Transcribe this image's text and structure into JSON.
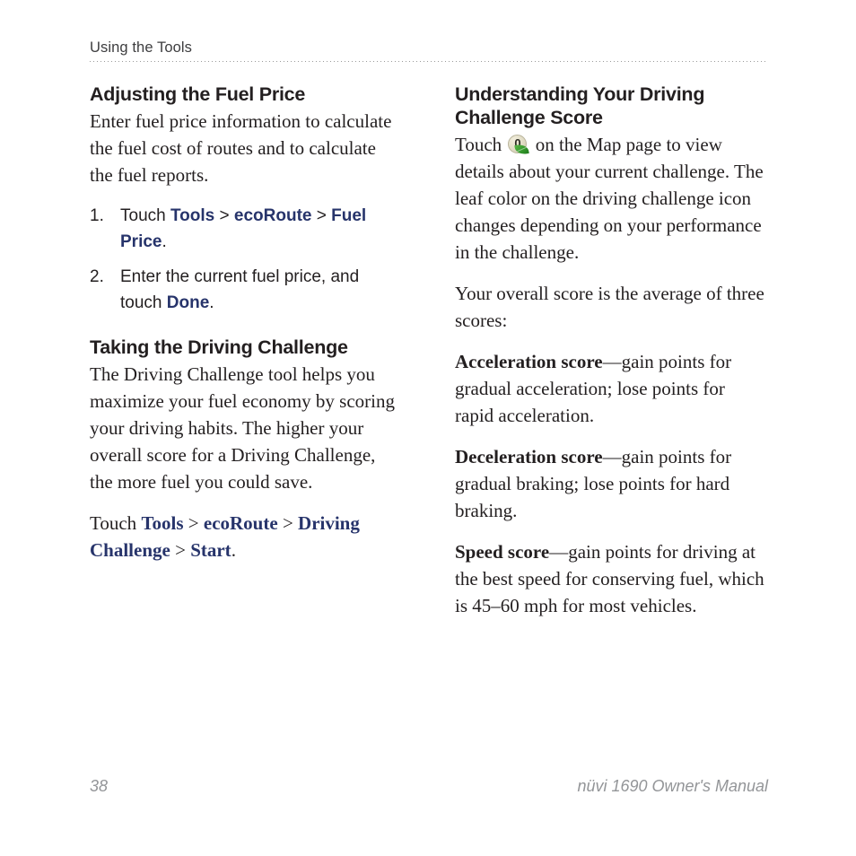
{
  "header": {
    "running_head": "Using the Tools"
  },
  "left_column": {
    "section1": {
      "heading": "Adjusting the Fuel Price",
      "intro": "Enter fuel price information to calculate the fuel cost of routes and to calculate the fuel reports.",
      "steps": [
        {
          "number": "1.",
          "prefix": "Touch ",
          "parts": [
            "Tools",
            " > ",
            "ecoRoute",
            " > ",
            "Fuel Price"
          ],
          "suffix": "."
        },
        {
          "number": "2.",
          "prefix": "Enter the current fuel price, and touch ",
          "parts": [
            "Done"
          ],
          "suffix": "."
        }
      ]
    },
    "section2": {
      "heading": "Taking the Driving Challenge",
      "intro": "The Driving Challenge tool helps you maximize your fuel economy by scoring your driving habits. The higher your overall score for a Driving Challenge, the more fuel you could save.",
      "path_sentence": {
        "prefix": "Touch ",
        "item1": "Tools",
        "sep1": " > ",
        "item2": "ecoRoute",
        "sep2": " > ",
        "item3": "Driving Challenge",
        "sep3": " > ",
        "item4": "Start",
        "suffix": "."
      }
    }
  },
  "right_column": {
    "heading": "Understanding Your Driving Challenge Score",
    "intro_before_icon": "Touch ",
    "icon": {
      "name": "driving-challenge-icon",
      "digit": "0",
      "disc_color": "#e4dfc8",
      "leaf_color": "#35992b"
    },
    "intro_after_icon": " on the Map page to view details about your current challenge. The leaf color on the driving challenge icon changes depending on your performance in the challenge.",
    "overall": "Your overall score is the average of three scores:",
    "scores": [
      {
        "label": "Acceleration score",
        "text": "—gain points for gradual acceleration; lose points for rapid acceleration."
      },
      {
        "label": "Deceleration score",
        "text": "—gain points for gradual braking; lose points for hard braking."
      },
      {
        "label": "Speed score",
        "text": "—gain points for driving at the best speed for conserving fuel, which is 45–60 mph for most vehicles."
      }
    ]
  },
  "footer": {
    "page_number": "38",
    "manual_title": "nüvi 1690 Owner's Manual"
  },
  "colors": {
    "ui_link_navy": "#27346b",
    "body_text": "#231f20",
    "footer_gray": "#939598",
    "rule_gray": "#9a9a9a"
  }
}
